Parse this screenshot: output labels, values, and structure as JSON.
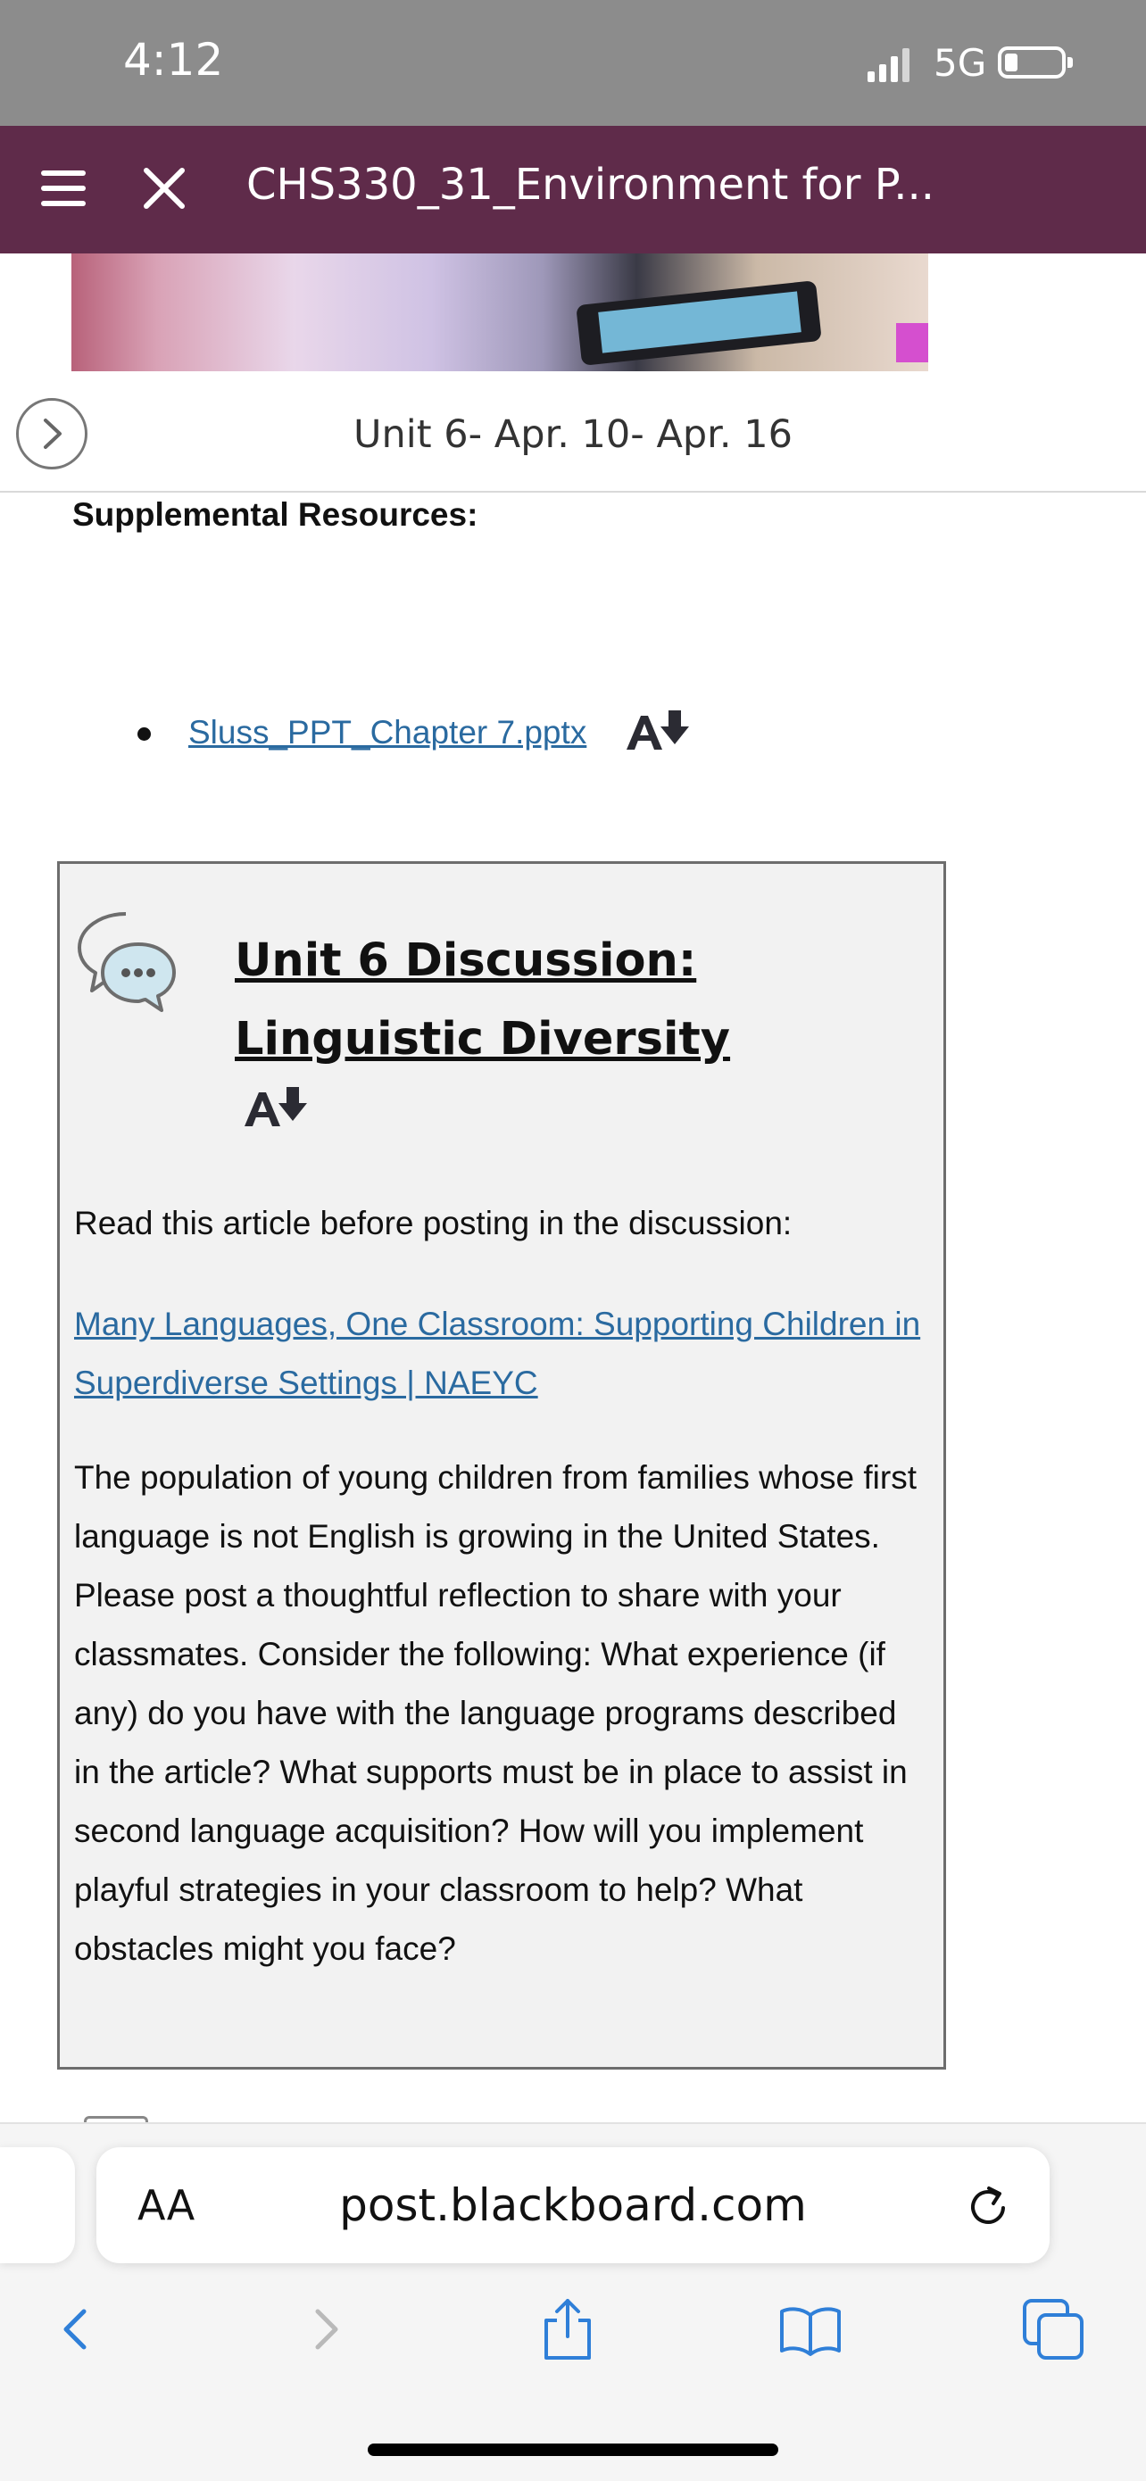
{
  "status_bar": {
    "time": "4:12",
    "network": "5G"
  },
  "app_bar": {
    "title": "CHS330_31_Environment for P..."
  },
  "unit_nav": {
    "label": "Unit 6- Apr. 10- Apr. 16"
  },
  "supplemental": {
    "heading": "Supplemental Resources:",
    "files": [
      {
        "label": "Sluss_PPT_Chapter 7.pptx"
      }
    ]
  },
  "discussion": {
    "title": "Unit 6 Discussion: Linguistic Diversity",
    "intro": "Read this article before posting in the discussion:",
    "article_link": "Many Languages, One Classroom: Supporting Children in Superdiverse Settings | NAEYC",
    "body": "The population of young children from families whose first language is not English is growing in the United States. Please post a thoughtful reflection to share with your classmates. Consider the following: What experience (if any) do you have with the language programs described in the article? What supports must be in place to assist in second language acquisition? How will you implement playful strategies in your classroom to help? What obstacles might you face?"
  },
  "browser": {
    "text_size_button": "AA",
    "url": "post.blackboard.com"
  },
  "icons": {
    "accessibility_download": "alternative-formats-icon",
    "discussion": "discussion-bubbles-icon"
  },
  "colors": {
    "app_bar": "#5f2b4a",
    "link": "#2a6aa0",
    "ios_blue": "#2f7fd8"
  }
}
